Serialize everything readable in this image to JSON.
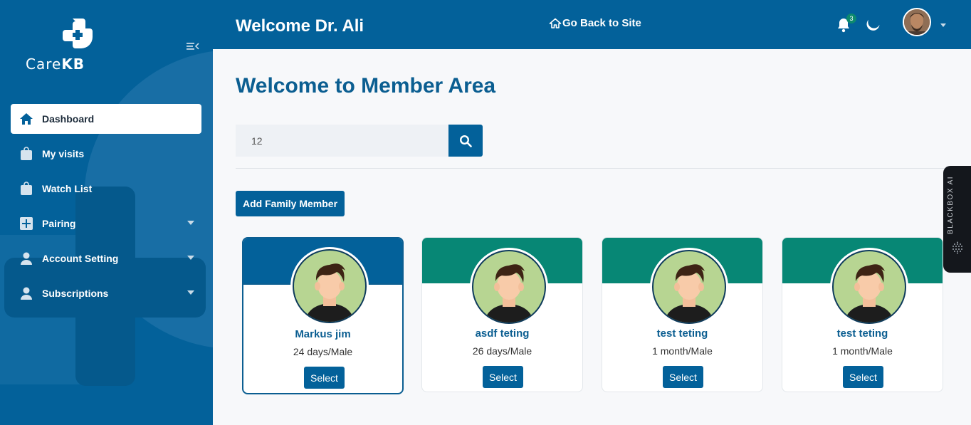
{
  "brand": {
    "logo_text_light": "Care",
    "logo_text_bold": "KB"
  },
  "sidebar": {
    "items": [
      {
        "label": "Dashboard",
        "icon": "home-icon",
        "active": true,
        "has_caret": false
      },
      {
        "label": "My visits",
        "icon": "bag-icon",
        "active": false,
        "has_caret": false
      },
      {
        "label": "Watch List",
        "icon": "bag-icon",
        "active": false,
        "has_caret": false
      },
      {
        "label": "Pairing",
        "icon": "plus-square-icon",
        "active": false,
        "has_caret": true
      },
      {
        "label": "Account Setting",
        "icon": "user-icon",
        "active": false,
        "has_caret": true
      },
      {
        "label": "Subscriptions",
        "icon": "user-icon",
        "active": false,
        "has_caret": true
      }
    ]
  },
  "header": {
    "title": "Welcome Dr. Ali",
    "back_link": "Go Back to Site",
    "notification_count": "3"
  },
  "main": {
    "page_title": "Welcome to Member Area",
    "search": {
      "value": "12",
      "placeholder": ""
    },
    "add_button": "Add Family Member",
    "members": [
      {
        "name": "Markus jim",
        "meta": "24 days/Male",
        "button": "Select",
        "selected": true
      },
      {
        "name": "asdf teting",
        "meta": "26 days/Male",
        "button": "Select",
        "selected": false
      },
      {
        "name": "test teting",
        "meta": "1 month/Male",
        "button": "Select",
        "selected": false
      },
      {
        "name": "test teting",
        "meta": "1 month/Male",
        "button": "Select",
        "selected": false
      }
    ]
  },
  "side_tab": {
    "label": "BLACKBOX AI"
  },
  "colors": {
    "primary": "#03619a",
    "teal": "#078775",
    "title": "#0b5e91",
    "background": "#f7f8fa"
  }
}
